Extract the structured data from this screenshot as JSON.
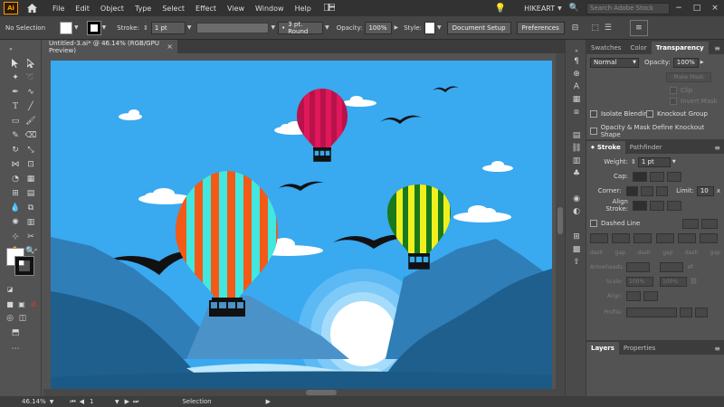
{
  "app": {
    "logo_text": "Ai",
    "menu": [
      "File",
      "Edit",
      "Object",
      "Type",
      "Select",
      "Effect",
      "View",
      "Window",
      "Help"
    ],
    "workspace": "HIKEART",
    "search_placeholder": "Search Adobe Stock",
    "window_buttons": [
      "−",
      "□",
      "×"
    ]
  },
  "control_bar": {
    "selection_label": "No Selection",
    "stroke_label": "Stroke:",
    "stroke_value": "1 pt",
    "brush_value": "3 pt. Round",
    "opacity_label": "Opacity:",
    "opacity_value": "100%",
    "style_label": "Style:",
    "doc_setup_label": "Document Setup",
    "preferences_label": "Preferences"
  },
  "document": {
    "tab_title": "Untitled-3.ai* @ 46.14% (RGB/GPU Preview)",
    "close_glyph": "×"
  },
  "status": {
    "zoom": "46.14%",
    "artboard_num": "1",
    "tool_name": "Selection"
  },
  "transparency_panel": {
    "tabs": [
      "Swatches",
      "Color",
      "Transparency"
    ],
    "active_tab": "Transparency",
    "blend_mode": "Normal",
    "opacity_label": "Opacity:",
    "opacity_value": "100%",
    "make_mask": "Make Mask",
    "clip": "Clip",
    "invert_mask": "Invert Mask",
    "isolate_blending": "Isolate Blending",
    "knockout_group": "Knockout Group",
    "opacity_mask_define": "Opacity & Mask Define Knockout Shape"
  },
  "stroke_panel": {
    "tabs": [
      "Stroke",
      "Pathfinder"
    ],
    "active_tab": "Stroke",
    "weight_label": "Weight:",
    "weight_value": "1 pt",
    "cap_label": "Cap:",
    "corner_label": "Corner:",
    "limit_label": "Limit:",
    "limit_value": "10",
    "limit_unit": "x",
    "align_label": "Align Stroke:",
    "dashed_line": "Dashed Line",
    "dash_gap": [
      "dash",
      "gap",
      "dash",
      "gap",
      "dash",
      "gap"
    ],
    "arrowheads_label": "Arrowheads:",
    "scale_label": "Scale:",
    "scale_value_1": "100%",
    "scale_value_2": "100%",
    "align_label_2": "Align:",
    "profile_label": "Profile:"
  },
  "layers_panel": {
    "tabs": [
      "Layers",
      "Properties"
    ],
    "active_tab": "Layers"
  },
  "colors": {
    "sky": "#39a9f0",
    "balloon_orange": "#f25a18",
    "balloon_cyan": "#40e8e0",
    "balloon_magenta": "#e0185a",
    "balloon_pink": "#b8124a",
    "balloon_yellow": "#f0f01e",
    "balloon_green": "#1a7a1a",
    "mountain_dark": "#1e5f8e",
    "mountain_mid": "#2f7eb8",
    "mountain_light": "#4a92c8",
    "sun": "#ffffff",
    "water": "#bfe8fb"
  }
}
